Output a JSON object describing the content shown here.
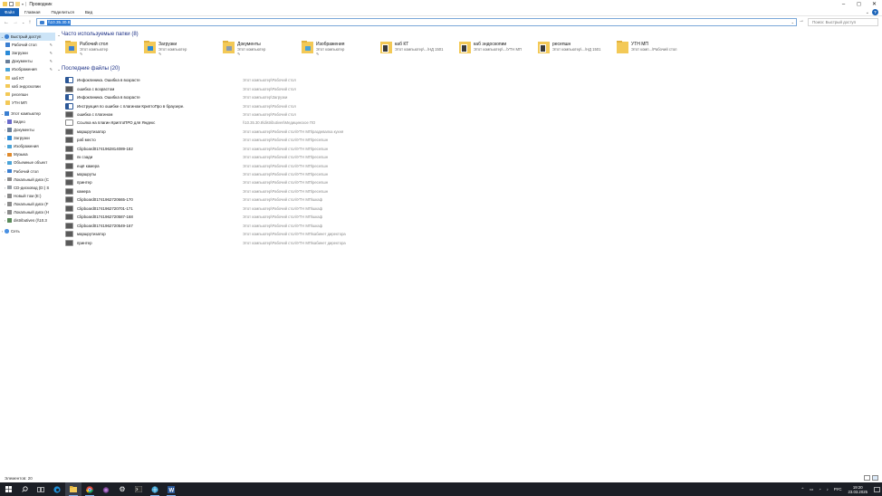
{
  "window": {
    "title": "Проводник",
    "controls": [
      "minimize-icon",
      "maximize-icon",
      "close-icon"
    ]
  },
  "ribbon": {
    "tabs": [
      "Файл",
      "Главная",
      "Поделиться",
      "Вид"
    ]
  },
  "address": {
    "value": "\\\\10.35.30.8",
    "search_placeholder": "Поиск: Быстрый доступ"
  },
  "nav": {
    "quick_access": {
      "label": "Быстрый доступ",
      "items": [
        {
          "label": "Рабочий стол",
          "icon": "desktop-icon",
          "pinned": true
        },
        {
          "label": "Загрузки",
          "icon": "downloads-icon",
          "pinned": true
        },
        {
          "label": "Документы",
          "icon": "documents-icon",
          "pinned": true
        },
        {
          "label": "Изображения",
          "icon": "pictures-icon",
          "pinned": true
        },
        {
          "label": "каб КТ",
          "icon": "folder-icon",
          "pinned": false
        },
        {
          "label": "каб эндоскопии",
          "icon": "folder-icon",
          "pinned": false
        },
        {
          "label": "ресепшн",
          "icon": "folder-icon",
          "pinned": false
        },
        {
          "label": "УТН МП",
          "icon": "folder-icon",
          "pinned": false
        }
      ]
    },
    "this_pc": {
      "label": "Этот компьютер",
      "items": [
        {
          "label": "Видео",
          "icon": "video-icon"
        },
        {
          "label": "Документы",
          "icon": "documents-icon"
        },
        {
          "label": "Загрузки",
          "icon": "downloads-icon"
        },
        {
          "label": "Изображения",
          "icon": "pictures-icon"
        },
        {
          "label": "Музыка",
          "icon": "music-icon"
        },
        {
          "label": "Объемные объект",
          "icon": "3d-objects-icon"
        },
        {
          "label": "Рабочий стол",
          "icon": "desktop-icon"
        },
        {
          "label": "Локальный диск (C",
          "icon": "drive-icon"
        },
        {
          "label": "CD-дисковод (D:) S",
          "icon": "cd-drive-icon"
        },
        {
          "label": "Новый том (E:)",
          "icon": "drive-icon"
        },
        {
          "label": "Локальный диск (F",
          "icon": "drive-icon"
        },
        {
          "label": "Локальный диск (H",
          "icon": "drive-icon"
        },
        {
          "label": "distributives (\\\\10.3",
          "icon": "network-drive-icon"
        }
      ]
    },
    "network": {
      "label": "Сеть"
    }
  },
  "frequent": {
    "header": "Часто используемые папки (8)",
    "tiles": [
      {
        "name": "Рабочий стол",
        "sub": "Этот компьютер",
        "pinned": true,
        "icon": "desktop-folder-icon"
      },
      {
        "name": "Загрузки",
        "sub": "Этот компьютер",
        "pinned": true,
        "icon": "downloads-folder-icon"
      },
      {
        "name": "Документы",
        "sub": "Этот компьютер",
        "pinned": true,
        "icon": "documents-folder-icon"
      },
      {
        "name": "Изображения",
        "sub": "Этот компьютер",
        "pinned": true,
        "icon": "pictures-folder-icon"
      },
      {
        "name": "каб КТ",
        "sub": "Этот компьютер\\...\\НД 1501",
        "pinned": false,
        "icon": "folder-thumbnail-icon"
      },
      {
        "name": "каб эндоскопии",
        "sub": "Этот компьютер\\...\\УТН МП",
        "pinned": false,
        "icon": "folder-thumbnail-icon"
      },
      {
        "name": "ресепшн",
        "sub": "Этот компьютер\\...\\НД 1501",
        "pinned": false,
        "icon": "folder-thumbnail-icon"
      },
      {
        "name": "УТН МП",
        "sub": "Этот комп...\\Рабочий стол",
        "pinned": false,
        "icon": "folder-icon"
      }
    ]
  },
  "recent": {
    "header": "Последние файлы (20)",
    "items": [
      {
        "name": "Инфоклиника. Ошибка в возрасте",
        "path": "Этот компьютер\\Рабочий стол",
        "icon": "document-icon"
      },
      {
        "name": "ошибка с возрастом",
        "path": "Этот компьютер\\Рабочий стол",
        "icon": "image-icon"
      },
      {
        "name": "Инфоклиника. Ошибка в возрасте",
        "path": "Этот компьютер\\Загрузки",
        "icon": "document-icon"
      },
      {
        "name": "Инструкция по ошибке с плагином КриптоПро в  браузере.",
        "path": "Этот компьютер\\Рабочий стол",
        "icon": "document-icon"
      },
      {
        "name": "ошибка с плагином",
        "path": "Этот компьютер\\Рабочий стол",
        "icon": "image-icon"
      },
      {
        "name": "Ссылка на плагин КриптоПРО для Яндекс",
        "path": "\\\\10.35.30.8\\distributives\\Медицинское ПО",
        "icon": "text-file-icon"
      },
      {
        "name": "маршрутизатор",
        "path": "Этот компьютер\\Рабочий стол\\УТН МП\\раздевалка кухня",
        "icon": "image-icon"
      },
      {
        "name": "раб место",
        "path": "Этот компьютер\\Рабочий стол\\УТН МП\\ресепшн",
        "icon": "image-icon"
      },
      {
        "name": "Clipboard01741962814089-182",
        "path": "Этот компьютер\\Рабочий стол\\УТН МП\\ресепшн",
        "icon": "image-icon"
      },
      {
        "name": "пк сзади",
        "path": "Этот компьютер\\Рабочий стол\\УТН МП\\ресепшн",
        "icon": "image-icon"
      },
      {
        "name": "ещё камера",
        "path": "Этот компьютер\\Рабочий стол\\УТН МП\\ресепшн",
        "icon": "image-icon"
      },
      {
        "name": "маршруты",
        "path": "Этот компьютер\\Рабочий стол\\УТН МП\\ресепшн",
        "icon": "image-icon"
      },
      {
        "name": "принтер",
        "path": "Этот компьютер\\Рабочий стол\\УТН МП\\ресепшн",
        "icon": "image-icon"
      },
      {
        "name": "камера",
        "path": "Этот компьютер\\Рабочий стол\\УТН МП\\ресепшн",
        "icon": "image-icon"
      },
      {
        "name": "Clipboard01741962720665-170",
        "path": "Этот компьютер\\Рабочий стол\\УТН МП\\шкаф",
        "icon": "image-icon"
      },
      {
        "name": "Clipboard01741962720701-171",
        "path": "Этот компьютер\\Рабочий стол\\УТН МП\\шкаф",
        "icon": "image-icon"
      },
      {
        "name": "Clipboard01741962720587-168",
        "path": "Этот компьютер\\Рабочий стол\\УТН МП\\шкаф",
        "icon": "image-icon"
      },
      {
        "name": "Clipboard01741962720549-167",
        "path": "Этот компьютер\\Рабочий стол\\УТН МП\\шкаф",
        "icon": "image-icon"
      },
      {
        "name": "маршрутизатор",
        "path": "Этот компьютер\\Рабочий стол\\УТН МП\\кабинет директора",
        "icon": "image-icon"
      },
      {
        "name": "принтер",
        "path": "Этот компьютер\\Рабочий стол\\УТН МП\\кабинет директора",
        "icon": "image-icon"
      }
    ]
  },
  "status": {
    "count": "Элементов: 20"
  },
  "taskbar": {
    "apps": [
      "windows-start-icon",
      "search-icon",
      "task-view-icon",
      "edge-icon",
      "file-explorer-icon",
      "chrome-icon",
      "tor-icon",
      "settings-icon",
      "terminal-icon",
      "network-app-icon",
      "word-icon"
    ],
    "lang": "РУС",
    "time": "19:20",
    "date": "23.03.2025"
  },
  "colors": {
    "accent": "#1a63b8",
    "folder": "#f3c957",
    "selection": "#cce4f7",
    "taskbar": "#1c1f26"
  }
}
